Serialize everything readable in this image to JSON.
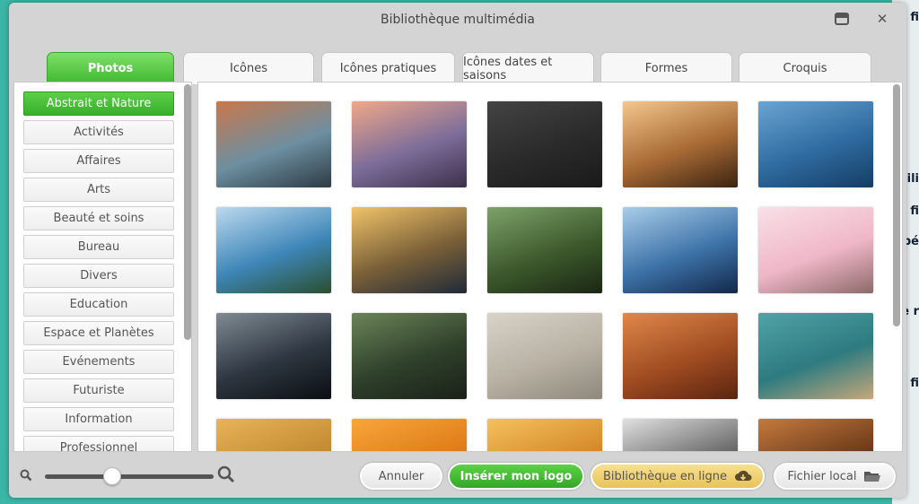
{
  "dialog": {
    "title": "Bibliothèque multimédia",
    "minimize_icon": "minimize-icon",
    "close_icon": "close-icon",
    "close_glyph": "✕"
  },
  "tabs": [
    {
      "label": "Photos",
      "active": true
    },
    {
      "label": "Icônes",
      "active": false
    },
    {
      "label": "Icônes pratiques",
      "active": false
    },
    {
      "label": "Icônes dates et saisons",
      "active": false
    },
    {
      "label": "Formes",
      "active": false
    },
    {
      "label": "Croquis",
      "active": false
    }
  ],
  "categories": [
    {
      "label": "Abstrait et Nature",
      "active": true
    },
    {
      "label": "Activités"
    },
    {
      "label": "Affaires"
    },
    {
      "label": "Arts"
    },
    {
      "label": "Beauté et soins"
    },
    {
      "label": "Bureau"
    },
    {
      "label": "Divers"
    },
    {
      "label": "Education"
    },
    {
      "label": "Espace et Planètes"
    },
    {
      "label": "Evénements"
    },
    {
      "label": "Futuriste"
    },
    {
      "label": "Information"
    },
    {
      "label": "Professionnel"
    }
  ],
  "thumbnails": [
    {
      "subject": "canyon river bend",
      "colors": [
        "#c9774a",
        "#6d8fa1",
        "#2d3b44"
      ]
    },
    {
      "subject": "lake sunset castle",
      "colors": [
        "#f0a889",
        "#7d6d9a",
        "#3c3049"
      ]
    },
    {
      "subject": "dark rain texture",
      "colors": [
        "#444444",
        "#2a2a2a",
        "#1a1a1a"
      ]
    },
    {
      "subject": "golden light streaks",
      "colors": [
        "#f4c78e",
        "#a86a35",
        "#3b2412"
      ]
    },
    {
      "subject": "blue ice crystals",
      "colors": [
        "#6aa4d2",
        "#2f6ba0",
        "#153d64"
      ]
    },
    {
      "subject": "mountain lake island",
      "colors": [
        "#bcd9ee",
        "#3e86b8",
        "#2a4f2f"
      ]
    },
    {
      "subject": "sunrise over fog",
      "colors": [
        "#f1c36a",
        "#7a6038",
        "#1f2a38"
      ]
    },
    {
      "subject": "leaf with water drops",
      "colors": [
        "#7ea26a",
        "#3d5a2c",
        "#1b2614"
      ]
    },
    {
      "subject": "blue misty mountains",
      "colors": [
        "#a9cde8",
        "#3e73a9",
        "#12284a"
      ]
    },
    {
      "subject": "pink cherry blossoms",
      "colors": [
        "#f9e0e8",
        "#f0b7c8",
        "#8c6a6a"
      ]
    },
    {
      "subject": "earth from space",
      "colors": [
        "#7f8a93",
        "#2d3640",
        "#0b0e12"
      ]
    },
    {
      "subject": "green cliffs waterfall",
      "colors": [
        "#6b8458",
        "#2f402b",
        "#1a2118"
      ]
    },
    {
      "subject": "sand ripples",
      "colors": [
        "#d8d3c8",
        "#b8b1a4",
        "#8e877b"
      ]
    },
    {
      "subject": "orange wood grain",
      "colors": [
        "#e0874a",
        "#a14d22",
        "#5b2410"
      ]
    },
    {
      "subject": "aerial coast teal",
      "colors": [
        "#4fa3a6",
        "#2e7b80",
        "#c6a77a"
      ]
    },
    {
      "subject": "wheat field",
      "colors": [
        "#e8b35a",
        "#c48b32",
        "#7a5118"
      ]
    },
    {
      "subject": "orange gradient sky",
      "colors": [
        "#f7a63a",
        "#e07c18",
        "#b55408"
      ]
    },
    {
      "subject": "orange sunset",
      "colors": [
        "#f4c15c",
        "#d68a2a",
        "#8c4c12"
      ]
    },
    {
      "subject": "black white texture",
      "colors": [
        "#e0e0e0",
        "#6a6a6a",
        "#111111"
      ]
    },
    {
      "subject": "brown mushrooms",
      "colors": [
        "#c47a3e",
        "#6e3b1a",
        "#231209"
      ]
    }
  ],
  "bottom": {
    "zoom_out_icon": "zoom-out-icon",
    "zoom_in_icon": "zoom-in-icon",
    "zoom_level": 0.4,
    "cancel_label": "Annuler",
    "insert_logo_label": "Insérer mon logo",
    "online_library_label": "Bibliothèque en ligne",
    "online_library_icon": "cloud-download-icon",
    "local_file_label": "Fichier local",
    "local_file_icon": "folder-icon"
  },
  "background": {
    "right_fragments": [
      "fi",
      "cili",
      "fi",
      "pé",
      "le r",
      "fi"
    ]
  }
}
